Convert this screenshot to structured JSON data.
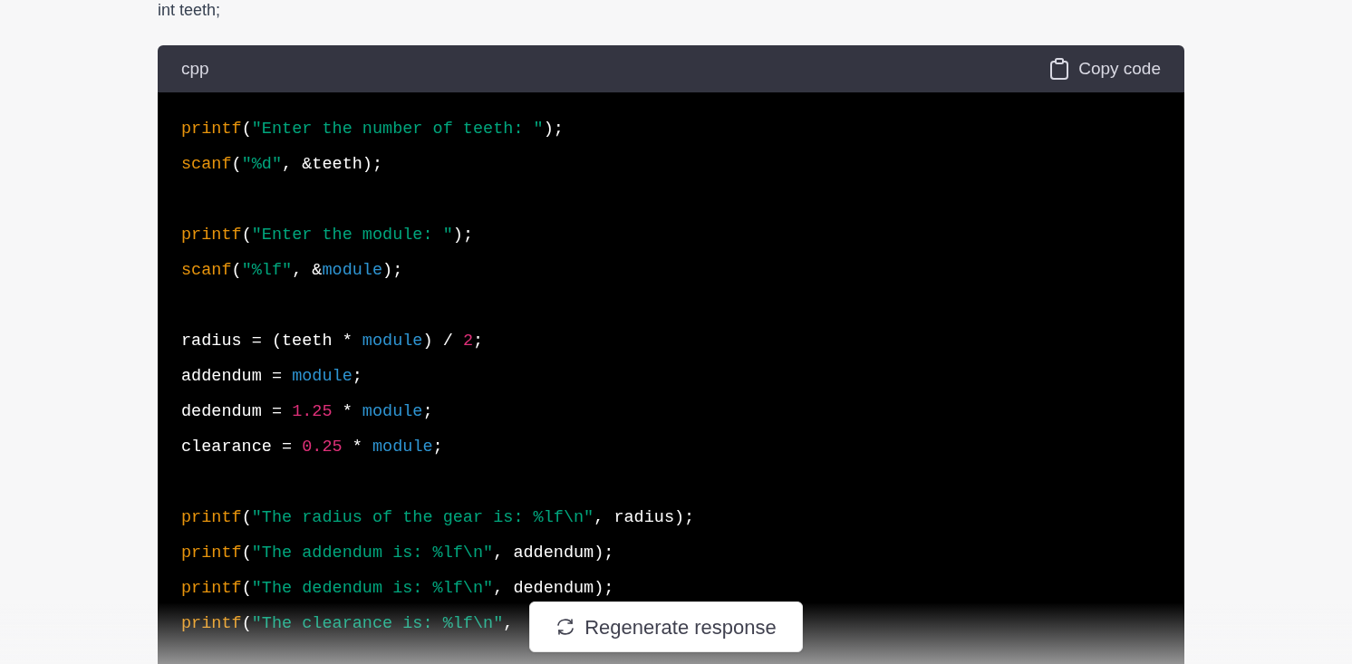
{
  "intro_text": "int teeth;",
  "code_block": {
    "language": "cpp",
    "copy_button": "Copy code",
    "lines": [
      {
        "kind": "code",
        "tokens": [
          {
            "text": "printf",
            "kind": "fn"
          },
          {
            "text": "(",
            "kind": "plain"
          },
          {
            "text": "\"Enter the number of teeth: \"",
            "kind": "str"
          },
          {
            "text": ");",
            "kind": "plain"
          }
        ]
      },
      {
        "kind": "code",
        "tokens": [
          {
            "text": "scanf",
            "kind": "fn"
          },
          {
            "text": "(",
            "kind": "plain"
          },
          {
            "text": "\"%d\"",
            "kind": "str"
          },
          {
            "text": ", &teeth);",
            "kind": "plain"
          }
        ]
      },
      {
        "kind": "blank"
      },
      {
        "kind": "code",
        "tokens": [
          {
            "text": "printf",
            "kind": "fn"
          },
          {
            "text": "(",
            "kind": "plain"
          },
          {
            "text": "\"Enter the module: \"",
            "kind": "str"
          },
          {
            "text": ");",
            "kind": "plain"
          }
        ]
      },
      {
        "kind": "code",
        "tokens": [
          {
            "text": "scanf",
            "kind": "fn"
          },
          {
            "text": "(",
            "kind": "plain"
          },
          {
            "text": "\"%lf\"",
            "kind": "str"
          },
          {
            "text": ", &",
            "kind": "plain"
          },
          {
            "text": "module",
            "kind": "var"
          },
          {
            "text": ");",
            "kind": "plain"
          }
        ]
      },
      {
        "kind": "blank"
      },
      {
        "kind": "code",
        "tokens": [
          {
            "text": "radius = (teeth * ",
            "kind": "plain"
          },
          {
            "text": "module",
            "kind": "var"
          },
          {
            "text": ") / ",
            "kind": "plain"
          },
          {
            "text": "2",
            "kind": "num"
          },
          {
            "text": ";",
            "kind": "plain"
          }
        ]
      },
      {
        "kind": "code",
        "tokens": [
          {
            "text": "addendum = ",
            "kind": "plain"
          },
          {
            "text": "module",
            "kind": "var"
          },
          {
            "text": ";",
            "kind": "plain"
          }
        ]
      },
      {
        "kind": "code",
        "tokens": [
          {
            "text": "dedendum = ",
            "kind": "plain"
          },
          {
            "text": "1.25",
            "kind": "num"
          },
          {
            "text": " * ",
            "kind": "plain"
          },
          {
            "text": "module",
            "kind": "var"
          },
          {
            "text": ";",
            "kind": "plain"
          }
        ]
      },
      {
        "kind": "code",
        "tokens": [
          {
            "text": "clearance = ",
            "kind": "plain"
          },
          {
            "text": "0.25",
            "kind": "num"
          },
          {
            "text": " * ",
            "kind": "plain"
          },
          {
            "text": "module",
            "kind": "var"
          },
          {
            "text": ";",
            "kind": "plain"
          }
        ]
      },
      {
        "kind": "blank"
      },
      {
        "kind": "code",
        "tokens": [
          {
            "text": "printf",
            "kind": "fn"
          },
          {
            "text": "(",
            "kind": "plain"
          },
          {
            "text": "\"The radius of the gear is: %lf\\n\"",
            "kind": "str"
          },
          {
            "text": ", radius);",
            "kind": "plain"
          }
        ]
      },
      {
        "kind": "code",
        "tokens": [
          {
            "text": "printf",
            "kind": "fn"
          },
          {
            "text": "(",
            "kind": "plain"
          },
          {
            "text": "\"The addendum is: %lf\\n\"",
            "kind": "str"
          },
          {
            "text": ", addendum);",
            "kind": "plain"
          }
        ]
      },
      {
        "kind": "code",
        "tokens": [
          {
            "text": "printf",
            "kind": "fn"
          },
          {
            "text": "(",
            "kind": "plain"
          },
          {
            "text": "\"The dedendum is: %lf\\n\"",
            "kind": "str"
          },
          {
            "text": ", dedendum);",
            "kind": "plain"
          }
        ]
      },
      {
        "kind": "code",
        "tokens": [
          {
            "text": "printf",
            "kind": "fn"
          },
          {
            "text": "(",
            "kind": "plain"
          },
          {
            "text": "\"The clearance is: %lf\\n\"",
            "kind": "str"
          },
          {
            "text": ",",
            "kind": "plain"
          }
        ]
      }
    ]
  },
  "regenerate_button": "Regenerate response"
}
